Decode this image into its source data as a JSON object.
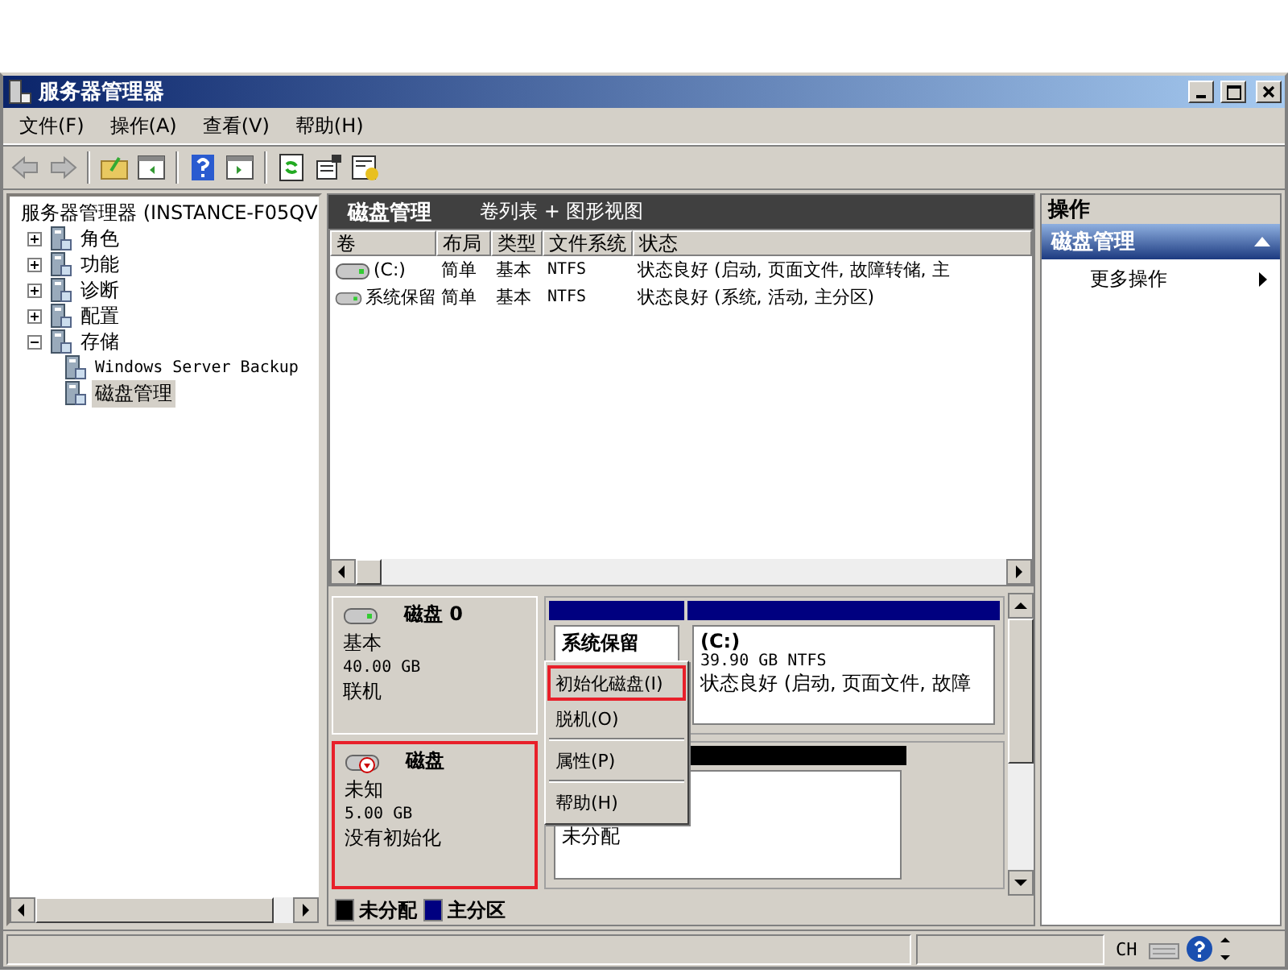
{
  "window": {
    "title": "服务器管理器"
  },
  "menu": [
    "文件(F)",
    "操作(A)",
    "查看(V)",
    "帮助(H)"
  ],
  "tree": {
    "label": "服务器管理器 (INSTANCE-F05QV",
    "children": [
      {
        "label": "角色",
        "expanded": false,
        "selected": false
      },
      {
        "label": "功能",
        "expanded": false,
        "selected": false
      },
      {
        "label": "诊断",
        "expanded": false,
        "selected": false
      },
      {
        "label": "配置",
        "expanded": false,
        "selected": false
      },
      {
        "label": "存储",
        "expanded": true,
        "selected": false,
        "children": [
          {
            "label": "Windows Server Backup",
            "selected": false
          },
          {
            "label": "磁盘管理",
            "selected": true
          }
        ]
      }
    ]
  },
  "center": {
    "title": "磁盘管理",
    "view": "卷列表 + 图形视图",
    "table": {
      "columns": [
        "卷",
        "布局",
        "类型",
        "文件系统",
        "状态"
      ],
      "rows": [
        [
          "(C:)",
          "简单",
          "基本",
          "NTFS",
          "状态良好 (启动, 页面文件, 故障转储, 主"
        ],
        [
          "系统保留",
          "简单",
          "基本",
          "NTFS",
          "状态良好 (系统, 活动, 主分区)"
        ]
      ]
    },
    "disks": [
      {
        "name": "磁盘 0",
        "type": "基本",
        "size": "40.00 GB",
        "status": "联机",
        "highlighted": false,
        "kind": "online",
        "partitions": [
          {
            "kind": "primary",
            "name": "系统保留"
          },
          {
            "kind": "primary",
            "name": "(C:)",
            "size": "39.90 GB NTFS",
            "status": "状态良好 (启动, 页面文件, 故障"
          }
        ]
      },
      {
        "name": "磁盘",
        "type": "未知",
        "size": "5.00 GB",
        "status": "没有初始化",
        "highlighted": true,
        "kind": "uninitialized",
        "partitions": [
          {
            "kind": "unallocated",
            "name": "未分配"
          }
        ]
      }
    ],
    "legend": [
      {
        "label": "未分配",
        "color": "#000000"
      },
      {
        "label": "主分区",
        "color": "#000080"
      }
    ],
    "context_menu": [
      {
        "kind": "item",
        "label": "初始化磁盘(I)",
        "highlighted": true
      },
      {
        "kind": "item",
        "label": "脱机(O)",
        "highlighted": false
      },
      {
        "kind": "separator"
      },
      {
        "kind": "item",
        "label": "属性(P)",
        "highlighted": false
      },
      {
        "kind": "separator"
      },
      {
        "kind": "item",
        "label": "帮助(H)",
        "highlighted": false
      }
    ]
  },
  "actions": {
    "title": "操作",
    "section": "磁盘管理",
    "items": [
      "更多操作"
    ]
  },
  "status_bar": {
    "language": "CH"
  }
}
